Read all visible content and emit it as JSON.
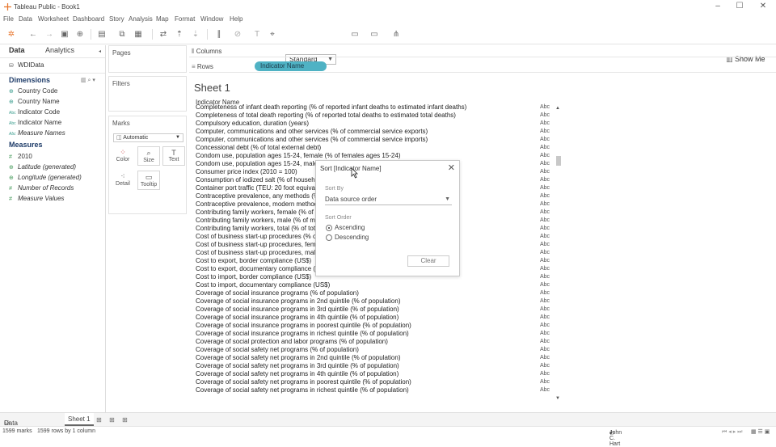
{
  "window": {
    "title": "Tableau Public - Book1"
  },
  "menu": [
    "File",
    "Data",
    "Worksheet",
    "Dashboard",
    "Story",
    "Analysis",
    "Map",
    "Format",
    "Window",
    "Help"
  ],
  "toolbar": {
    "fit_value": "Standard",
    "show_me": "Show Me"
  },
  "left": {
    "tab_data": "Data",
    "tab_analytics": "Analytics",
    "datasource": "WDIData",
    "dimensions_label": "Dimensions",
    "dimensions": [
      {
        "icon": "globe",
        "label": "Country Code"
      },
      {
        "icon": "globe",
        "label": "Country Name"
      },
      {
        "icon": "Abc",
        "label": "Indicator Code"
      },
      {
        "icon": "Abc",
        "label": "Indicator Name"
      },
      {
        "icon": "Abc",
        "label": "Measure Names"
      }
    ],
    "measures_label": "Measures",
    "measures": [
      {
        "icon": "#",
        "label": "2010"
      },
      {
        "icon": "globe",
        "label": "Latitude (generated)"
      },
      {
        "icon": "globe",
        "label": "Longitude (generated)"
      },
      {
        "icon": "#",
        "label": "Number of Records"
      },
      {
        "icon": "#",
        "label": "Measure Values"
      }
    ]
  },
  "cards": {
    "pages": "Pages",
    "filters": "Filters",
    "marks": "Marks",
    "mark_type": "Automatic",
    "mark_buttons": [
      "Color",
      "Size",
      "Text",
      "Detail",
      "Tooltip"
    ]
  },
  "shelves": {
    "columns": "Columns",
    "rows": "Rows",
    "rows_pill": "Indicator Name"
  },
  "sheet": {
    "title": "Sheet 1",
    "column_header": "Indicator Name",
    "abc": "Abc",
    "rows": [
      "Completeness of infant death reporting (% of reported infant deaths to estimated infant deaths)",
      "Completeness of total death reporting (% of reported total deaths to estimated total deaths)",
      "Compulsory education, duration (years)",
      "Computer, communications and other services (% of commercial service exports)",
      "Computer, communications and other services (% of commercial service imports)",
      "Concessional debt (% of total external debt)",
      "Condom use, population ages 15-24, female (% of females ages 15-24)",
      "Condom use, population ages 15-24, male (% of males ages 15-24)",
      "Consumer price index (2010 = 100)",
      "Consumption of iodized salt (% of households)",
      "Container port traffic (TEU: 20 foot equivalent units)",
      "Contraceptive prevalence, any methods (% of women ages 15-49)",
      "Contraceptive prevalence, modern methods (% of women ages 15-49)",
      "Contributing family workers, female (% of female employment)",
      "Contributing family workers, male (% of male employment)",
      "Contributing family workers, total (% of total employment)",
      "Cost of business start-up procedures (% of GNI per capita)",
      "Cost of business start-up procedures, female (% of GNI per capita)",
      "Cost of business start-up procedures, male (% of GNI per capita)",
      "Cost to export, border compliance (US$)",
      "Cost to export, documentary compliance (US$)",
      "Cost to import, border compliance (US$)",
      "Cost to import, documentary compliance (US$)",
      "Coverage of social insurance programs (% of population)",
      "Coverage of social insurance programs in 2nd quintile (% of population)",
      "Coverage of social insurance programs in 3rd quintile (% of population)",
      "Coverage of social insurance programs in 4th quintile (% of population)",
      "Coverage of social insurance programs in poorest quintile (% of population)",
      "Coverage of social insurance programs in richest quintile (% of population)",
      "Coverage of social protection and labor programs (% of population)",
      "Coverage of social safety net programs (% of population)",
      "Coverage of social safety net programs in 2nd quintile (% of population)",
      "Coverage of social safety net programs in 3rd quintile (% of population)",
      "Coverage of social safety net programs in 4th quintile (% of population)",
      "Coverage of social safety net programs in poorest quintile (% of population)",
      "Coverage of social safety net programs in richest quintile (% of population)"
    ]
  },
  "dialog": {
    "title": "Sort [Indicator Name]",
    "sort_by_label": "Sort By",
    "sort_by_value": "Data source order",
    "sort_order_label": "Sort Order",
    "ascending": "Ascending",
    "descending": "Descending",
    "clear": "Clear"
  },
  "bottom": {
    "data_source": "Data Source",
    "sheet1": "Sheet 1"
  },
  "status": {
    "marks": "1599 marks",
    "rows": "1599 rows by 1 column",
    "user": "John C. Hart"
  }
}
